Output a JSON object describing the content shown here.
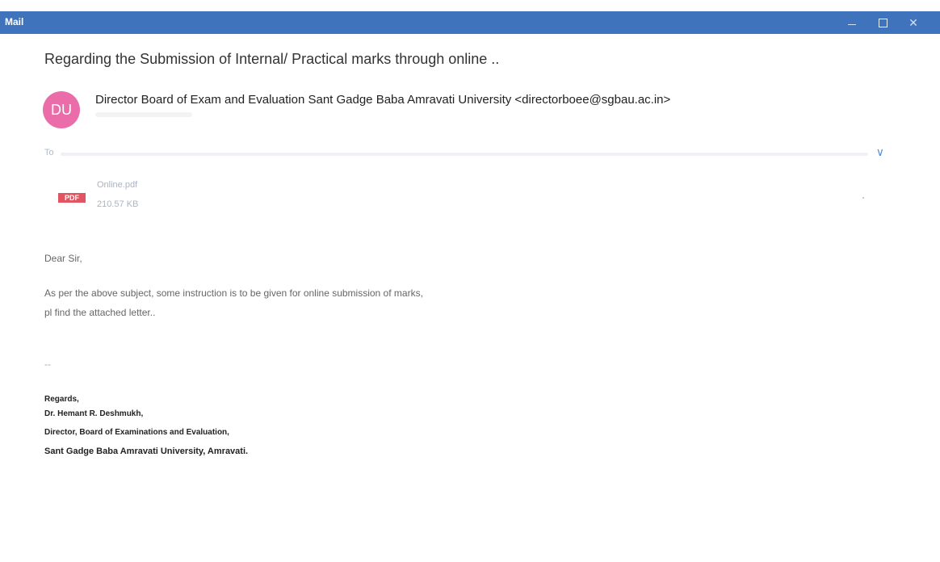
{
  "window": {
    "title": "Mail",
    "controls": [
      "minimize-icon",
      "maximize-icon",
      "close-icon"
    ],
    "close_glyph": "✕"
  },
  "message": {
    "subject": "Regarding the Submission of Internal/ Practical marks through online ..",
    "avatar_initials": "DU",
    "avatar_color": "#ea6ca8",
    "sender": "Director Board of Exam and Evaluation Sant Gadge Baba Amravati University <directorboee@sgbau.ac.in>",
    "to_label": "To",
    "expand_glyph": "∨"
  },
  "attachment": {
    "badge": "PDF",
    "name": "Online.pdf",
    "size": "210.57 KB"
  },
  "body": {
    "greeting": "Dear Sir,",
    "line1": "As per the above subject, some instruction is to be given for online submission of marks,",
    "line2": "pl find the attached letter..",
    "separator": "--"
  },
  "signature": {
    "regards": "Regards,",
    "name": "Dr. Hemant R. Deshmukh,",
    "title": "Director, Board of Examinations and Evaluation,",
    "org": "Sant Gadge Baba Amravati University, Amravati."
  },
  "colors": {
    "titlebar": "#3f73bb",
    "pdf_badge": "#e05561"
  }
}
